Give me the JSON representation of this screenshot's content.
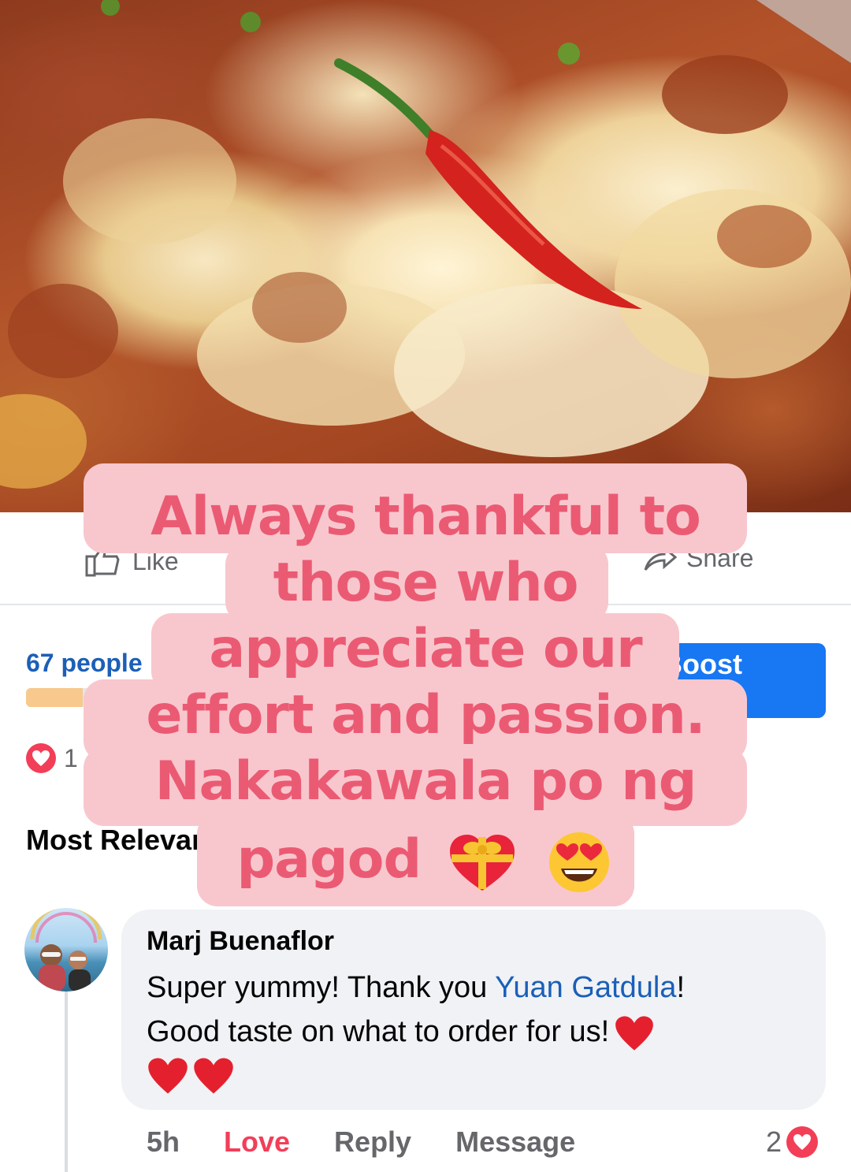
{
  "post_actions": {
    "like_label": "Like",
    "share_label": "Share"
  },
  "reach": {
    "text": "67 people",
    "progress_pct": 9
  },
  "boost_button": {
    "label": "Boost Post"
  },
  "reactions": {
    "count": "1"
  },
  "comments_sort": {
    "label": "Most Relevant"
  },
  "overlay_caption": {
    "lines": [
      "Always thankful to",
      "those who",
      "appreciate our",
      "effort and passion.",
      "Nakakawala po ng",
      "pagod"
    ],
    "emojis": [
      "heart-with-ribbon-emoji",
      "heart-eyes-emoji"
    ]
  },
  "comment": {
    "author": "Marj Buenaflor",
    "text_before_mention": "Super yummy! Thank you ",
    "mention": "Yuan Gatdula",
    "text_after_mention": "!",
    "line2": "Good taste on what to order for us!",
    "time": "5h",
    "reaction_label": "Love",
    "reply_label": "Reply",
    "message_label": "Message",
    "reaction_count": "2"
  },
  "colors": {
    "overlay_bg": "#f8c7cd",
    "overlay_text": "#eb5a73",
    "boost_blue": "#1877f2",
    "love_red": "#f33e58",
    "mention_blue": "#1b5fb8"
  }
}
